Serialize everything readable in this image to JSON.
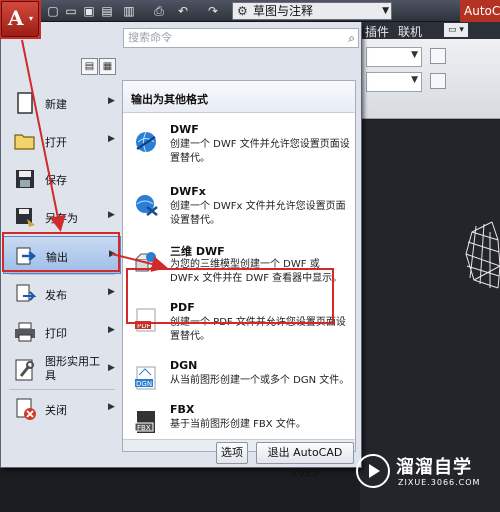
{
  "titlebar": {
    "workspace": "草图与注释",
    "app_title": "AutoCAD",
    "quick_access": [
      "new-icon",
      "open-icon",
      "save-icon",
      "save-as-icon",
      "publish-icon",
      "print-icon",
      "undo-icon",
      "redo-icon"
    ]
  },
  "ribbon": {
    "tabs": [
      "插件",
      "联机"
    ]
  },
  "app_menu": {
    "search_placeholder": "搜索命令",
    "nav": [
      {
        "label": "新建",
        "icon": "new-doc-icon",
        "arrow": true
      },
      {
        "label": "打开",
        "icon": "open-folder-icon",
        "arrow": true
      },
      {
        "label": "保存",
        "icon": "save-icon",
        "arrow": false
      },
      {
        "label": "另存为",
        "icon": "save-as-icon",
        "arrow": true
      },
      {
        "label": "输出",
        "icon": "export-icon",
        "arrow": true,
        "active": true
      },
      {
        "label": "发布",
        "icon": "publish-icon",
        "arrow": true
      },
      {
        "label": "打印",
        "icon": "printer-icon",
        "arrow": true
      },
      {
        "label": "图形实用工具",
        "icon": "wrench-icon",
        "arrow": true
      },
      {
        "label": "关闭",
        "icon": "close-doc-icon",
        "arrow": true
      }
    ],
    "submenu": {
      "heading": "输出为其他格式",
      "items": [
        {
          "title": "DWF",
          "desc": "创建一个 DWF 文件并允许您设置页面设置替代。",
          "icon": "dwf-globe-icon"
        },
        {
          "title": "DWFx",
          "desc": "创建一个 DWFx 文件并允许您设置页面设置替代。",
          "icon": "dwfx-globe-icon"
        },
        {
          "title": "三维 DWF",
          "desc": "为您的三维模型创建一个 DWF 或 DWFx 文件并在 DWF 查看器中显示。",
          "icon": "dwf3d-icon"
        },
        {
          "title": "PDF",
          "desc": "创建一个 PDF 文件并允许您设置页面设置替代。",
          "icon": "pdf-icon"
        },
        {
          "title": "DGN",
          "desc": "从当前图形创建一个或多个 DGN 文件。",
          "icon": "dgn-icon"
        },
        {
          "title": "FBX",
          "desc": "基于当前图形创建 FBX 文件。",
          "icon": "fbx-icon"
        }
      ]
    },
    "buttons": {
      "options": "选项",
      "exit": "退出 AutoCAD 2013"
    }
  },
  "watermark": {
    "name": "溜溜自学",
    "url": "ZIXUE.3066.COM"
  },
  "colors": {
    "annotation": "#d02a2a",
    "app_button": "#b02a1d",
    "active_nav": "#9ebde8"
  }
}
